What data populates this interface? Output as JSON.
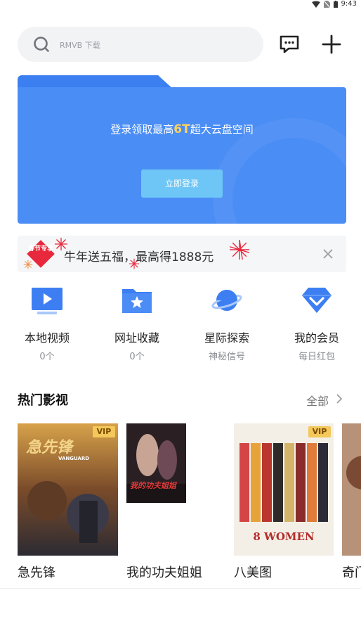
{
  "status": {
    "time": "9:43"
  },
  "search": {
    "placeholder": "RMVB 下载"
  },
  "cloud": {
    "promo_prefix": "登录领取最高",
    "promo_highlight": "6T",
    "promo_suffix": "超大云盘空间",
    "login_label": "立即登录"
  },
  "festival": {
    "badge": "春节专享",
    "text": "牛年送五福，最高得1888元"
  },
  "quick": [
    {
      "label": "本地视频",
      "sub": "0个",
      "icon": "video-play-icon"
    },
    {
      "label": "网址收藏",
      "sub": "0个",
      "icon": "folder-star-icon"
    },
    {
      "label": "星际探索",
      "sub": "神秘信号",
      "icon": "planet-icon"
    },
    {
      "label": "我的会员",
      "sub": "每日红包",
      "icon": "vip-diamond-icon"
    }
  ],
  "section": {
    "title": "热门影视",
    "more": "全部"
  },
  "movies": [
    {
      "title": "急先锋",
      "vip": "VIP",
      "poster_text": "急先锋",
      "poster_sub": "VANGUARD"
    },
    {
      "title": "我的功夫姐姐",
      "vip": "",
      "poster_text": "我的功夫姐姐"
    },
    {
      "title": "八美图",
      "vip": "VIP",
      "poster_text": "8 WOMEN"
    },
    {
      "title": "奇门",
      "vip": ""
    }
  ],
  "colors": {
    "card_blue": "#4a8df5",
    "login_button": "#6ec6f6",
    "highlight_yellow": "#ffd35a",
    "vip_gold": "#f4c85a",
    "icon_blue": "#3d7ff3"
  }
}
